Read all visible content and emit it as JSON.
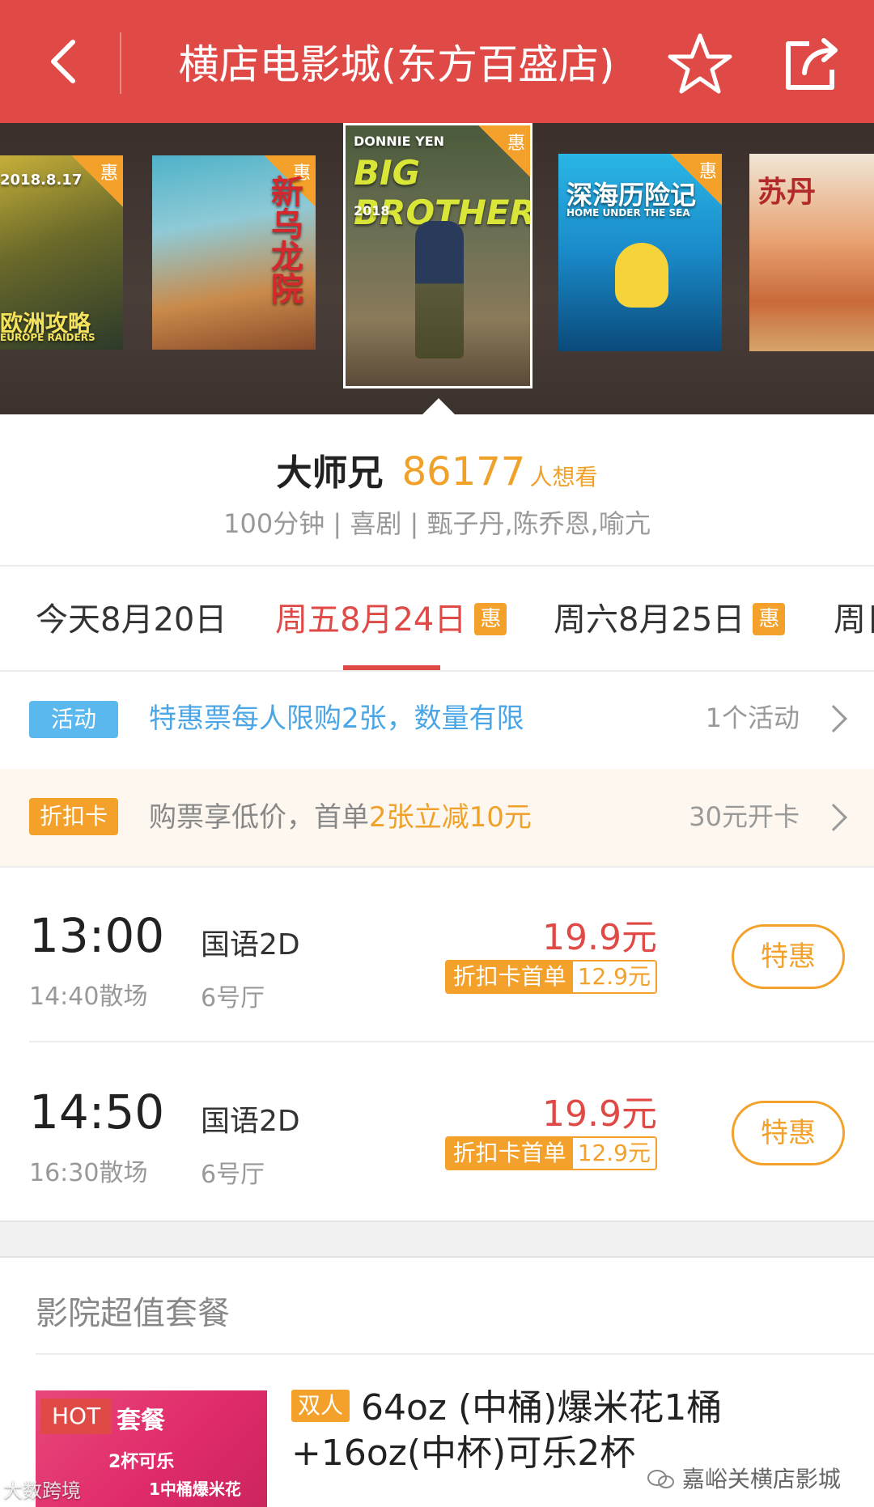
{
  "header": {
    "title": "横店电影城(东方百盛店)",
    "bg_color": "#e04a46",
    "icons": [
      "back-arrow-icon",
      "star-icon",
      "share-icon"
    ]
  },
  "carousel": {
    "posters": [
      {
        "date": "2018.8.17",
        "title": "欧洲攻略",
        "subtitle": "EUROPE RAIDERS",
        "badge": "惠"
      },
      {
        "title": "新乌龙院",
        "badge": "惠"
      },
      {
        "top_text": "DONNIE YEN",
        "title": "BIG BROTHER",
        "year": "2018",
        "badge": "惠",
        "selected": true
      },
      {
        "title": "深海历险记",
        "subtitle": "HOME UNDER THE SEA",
        "badge": "惠"
      },
      {
        "title": "苏丹"
      }
    ]
  },
  "movie": {
    "name": "大师兄",
    "want_count": "86177",
    "want_label": "人想看",
    "meta": "100分钟 | 喜剧 | 甄子丹,陈乔恩,喻亢"
  },
  "dates": [
    {
      "label": "今天8月20日",
      "tag": ""
    },
    {
      "label": "周五8月24日",
      "tag": "惠"
    },
    {
      "label": "周六8月25日",
      "tag": "惠"
    },
    {
      "label": "周日"
    }
  ],
  "activity": {
    "tag": "活动",
    "text": "特惠票每人限购2张，数量有限",
    "count": "1个活动"
  },
  "discount_card": {
    "tag": "折扣卡",
    "text_prefix": "购票享低价，首单",
    "text_highlight": "2张立减10元",
    "price": "30元开卡"
  },
  "showtimes": [
    {
      "start": "13:00",
      "end": "14:40散场",
      "lang": "国语2D",
      "hall": "6号厅",
      "price": "19.9元",
      "card_label": "折扣卡首单",
      "card_price": "12.9元",
      "button": "特惠"
    },
    {
      "start": "14:50",
      "end": "16:30散场",
      "lang": "国语2D",
      "hall": "6号厅",
      "price": "19.9元",
      "card_label": "折扣卡首单",
      "card_price": "12.9元",
      "button": "特惠"
    }
  ],
  "packages": {
    "section_title": "影院超值套餐",
    "items": [
      {
        "hot": "HOT",
        "image_text_1": "套餐",
        "image_text_2": "2杯可乐",
        "image_text_3": "1中桶爆米花",
        "tag": "双人",
        "name": "64oz (中桶)爆米花1桶+16oz(中杯)可乐2杯"
      }
    ]
  },
  "watermarks": {
    "left": "大数跨境",
    "right": "嘉峪关横店影城"
  }
}
